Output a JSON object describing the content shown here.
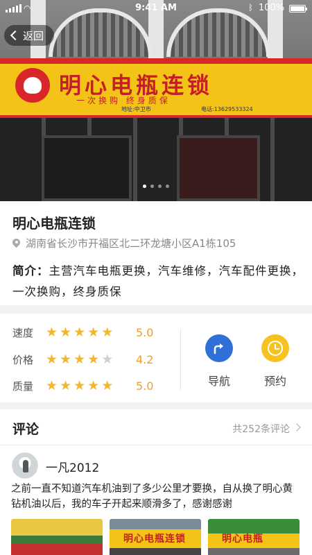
{
  "status_bar": {
    "time": "9:41 AM",
    "battery": "100%"
  },
  "nav": {
    "back_label": "返回"
  },
  "hero": {
    "sign_name": "明心电瓶连锁",
    "sign_slogan": "一次换购 终身质保",
    "sign_address": "地址:中卫市",
    "sign_phone": "电话:13629533324",
    "slide_count": 4,
    "active_slide": 1
  },
  "shop": {
    "name": "明心电瓶连锁",
    "address": "湖南省长沙市开福区北二环龙塘小区A1栋105",
    "intro_label": "简介：",
    "intro_text": "主营汽车电瓶更换，汽车维修，汽车配件更换，一次换购，终身质保"
  },
  "ratings": [
    {
      "label": "速度",
      "stars": 5,
      "score": "5.0"
    },
    {
      "label": "价格",
      "stars": 4,
      "score": "4.2"
    },
    {
      "label": "质量",
      "stars": 5,
      "score": "5.0"
    }
  ],
  "actions": {
    "navigate_label": "导航",
    "book_label": "预约"
  },
  "comments": {
    "title": "评论",
    "count_text": "共252条评论",
    "first": {
      "user": "一凡2012",
      "text": "之前一直不知道汽车机油到了多少公里才要换，自从换了明心黄钻机油以后，我的车子开起来顺滑多了，感谢感谢"
    },
    "thumb_signs": [
      "",
      "明心电瓶连锁",
      "明心电瓶"
    ]
  },
  "colors": {
    "accent_star": "#f4b72b",
    "score": "#f0a020",
    "nav_blue": "#2f6fd6",
    "book_yellow": "#f7c21d"
  }
}
